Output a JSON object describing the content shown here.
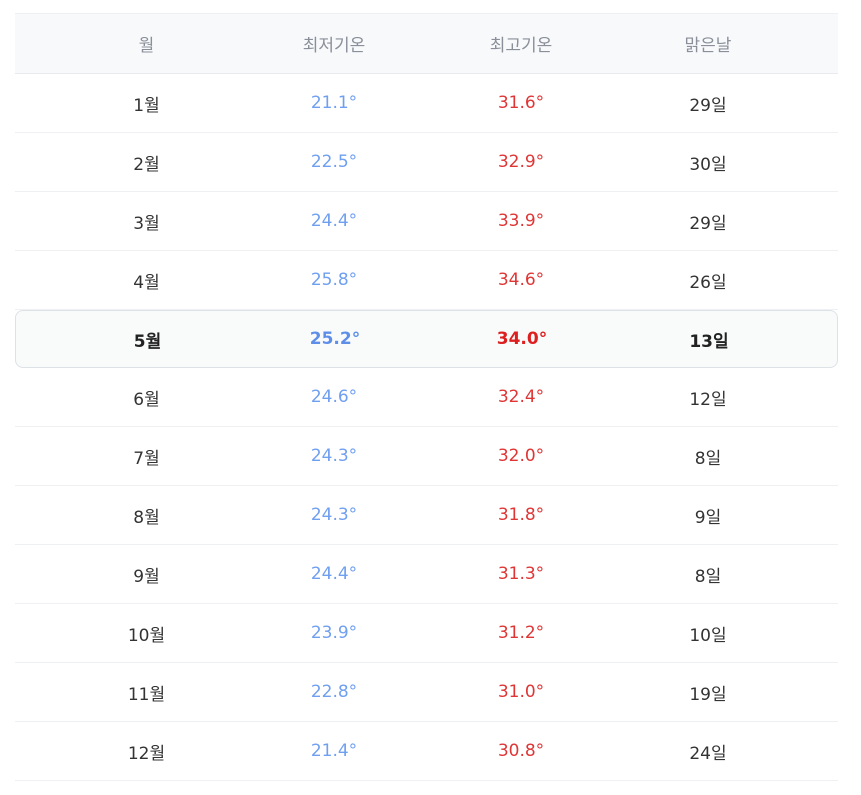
{
  "table": {
    "headers": [
      "월",
      "최저기온",
      "최고기온",
      "맑은날"
    ],
    "rows": [
      {
        "month": "1월",
        "low": "21.1°",
        "high": "31.6°",
        "sunny": "29일"
      },
      {
        "month": "2월",
        "low": "22.5°",
        "high": "32.9°",
        "sunny": "30일"
      },
      {
        "month": "3월",
        "low": "24.4°",
        "high": "33.9°",
        "sunny": "29일"
      },
      {
        "month": "4월",
        "low": "25.8°",
        "high": "34.6°",
        "sunny": "26일"
      },
      {
        "month": "5월",
        "low": "25.2°",
        "high": "34.0°",
        "sunny": "13일"
      },
      {
        "month": "6월",
        "low": "24.6°",
        "high": "32.4°",
        "sunny": "12일"
      },
      {
        "month": "7월",
        "low": "24.3°",
        "high": "32.0°",
        "sunny": "8일"
      },
      {
        "month": "8월",
        "low": "24.3°",
        "high": "31.8°",
        "sunny": "9일"
      },
      {
        "month": "9월",
        "low": "24.4°",
        "high": "31.3°",
        "sunny": "8일"
      },
      {
        "month": "10월",
        "low": "23.9°",
        "high": "31.2°",
        "sunny": "10일"
      },
      {
        "month": "11월",
        "low": "22.8°",
        "high": "31.0°",
        "sunny": "19일"
      },
      {
        "month": "12월",
        "low": "21.4°",
        "high": "30.8°",
        "sunny": "24일"
      }
    ],
    "highlighted_month": "5월"
  },
  "colors": {
    "low_temp": "#6f9ff0",
    "high_temp": "#e03535",
    "header_bg": "#f8f9fb"
  }
}
